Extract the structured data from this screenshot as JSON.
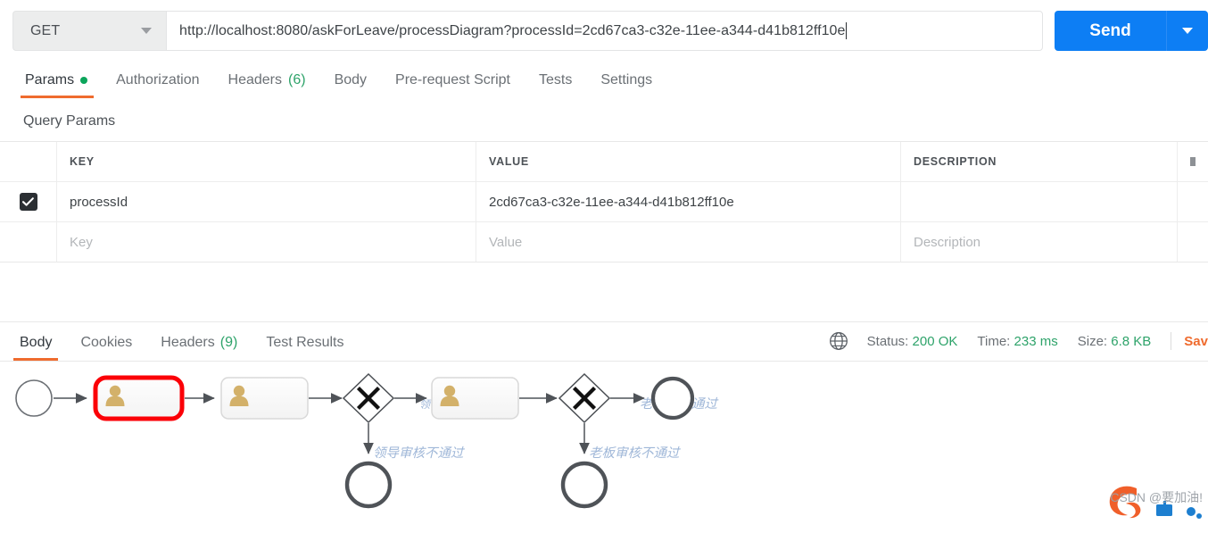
{
  "request": {
    "method": "GET",
    "method_caret_icon": "chevron-down-icon",
    "url": "http://localhost:8080/askForLeave/processDiagram?processId=2cd67ca3-c32e-11ee-a344-d41b812ff10e",
    "send_label": "Send",
    "send_caret_icon": "chevron-down-icon"
  },
  "request_tabs": [
    {
      "label": "Params",
      "badge": "",
      "dot": true,
      "active": true
    },
    {
      "label": "Authorization",
      "badge": "",
      "dot": false,
      "active": false
    },
    {
      "label": "Headers",
      "badge": "(6)",
      "dot": false,
      "active": false
    },
    {
      "label": "Body",
      "badge": "",
      "dot": false,
      "active": false
    },
    {
      "label": "Pre-request Script",
      "badge": "",
      "dot": false,
      "active": false
    },
    {
      "label": "Tests",
      "badge": "",
      "dot": false,
      "active": false
    },
    {
      "label": "Settings",
      "badge": "",
      "dot": false,
      "active": false
    }
  ],
  "query_params": {
    "title": "Query Params",
    "columns": [
      "KEY",
      "VALUE",
      "DESCRIPTION"
    ],
    "rows": [
      {
        "checked": true,
        "key": "processId",
        "value": "2cd67ca3-c32e-11ee-a344-d41b812ff10e",
        "description": ""
      }
    ],
    "placeholder_row": {
      "key": "Key",
      "value": "Value",
      "description": "Description"
    },
    "bulk_edit_icon": "bulk-edit-icon"
  },
  "response_tabs": [
    {
      "label": "Body",
      "badge": "",
      "active": true
    },
    {
      "label": "Cookies",
      "badge": "",
      "active": false
    },
    {
      "label": "Headers",
      "badge": "(9)",
      "active": false
    },
    {
      "label": "Test Results",
      "badge": "",
      "active": false
    }
  ],
  "response_meta": {
    "globe_icon": "globe-icon",
    "status_label": "Status:",
    "status_value": "200 OK",
    "time_label": "Time:",
    "time_value": "233 ms",
    "size_label": "Size:",
    "size_value": "6.8 KB",
    "save_response_label": "Sav"
  },
  "colors": {
    "accent_orange": "#ef6b2e",
    "send_blue": "#0d7ef4",
    "status_green": "#2ea36a",
    "highlight_red": "#fb0007",
    "task_icon_gold": "#d3b16a",
    "diagram_stroke": "#585858",
    "label_blue": "#9fb7d8"
  },
  "diagram": {
    "type": "bpmn-process-diagram",
    "nodes": [
      {
        "id": "start",
        "type": "start-event",
        "label": ""
      },
      {
        "id": "task1",
        "type": "user-task",
        "label": "",
        "highlighted": true
      },
      {
        "id": "task2",
        "type": "user-task",
        "label": "",
        "highlighted": false
      },
      {
        "id": "gateway1",
        "type": "exclusive-gateway",
        "label": ""
      },
      {
        "id": "task3",
        "type": "user-task",
        "label": "",
        "highlighted": false
      },
      {
        "id": "gateway2",
        "type": "exclusive-gateway",
        "label": ""
      },
      {
        "id": "end-approved",
        "type": "end-event",
        "label": ""
      },
      {
        "id": "end-reject-leader",
        "type": "end-event",
        "label": ""
      },
      {
        "id": "end-reject-boss",
        "type": "end-event",
        "label": ""
      }
    ],
    "flow_labels": [
      {
        "id": "leader-reject",
        "text": "领导审核不通过"
      },
      {
        "id": "boss-reject",
        "text": "老板审核不通过"
      },
      {
        "id": "boss-approve",
        "text": "老板审核通过"
      },
      {
        "id": "leader-approve-partial",
        "text": "领"
      }
    ]
  },
  "watermark": {
    "text": "CSDN @要加油!",
    "logo_icon": "csdn-logo-icon"
  }
}
